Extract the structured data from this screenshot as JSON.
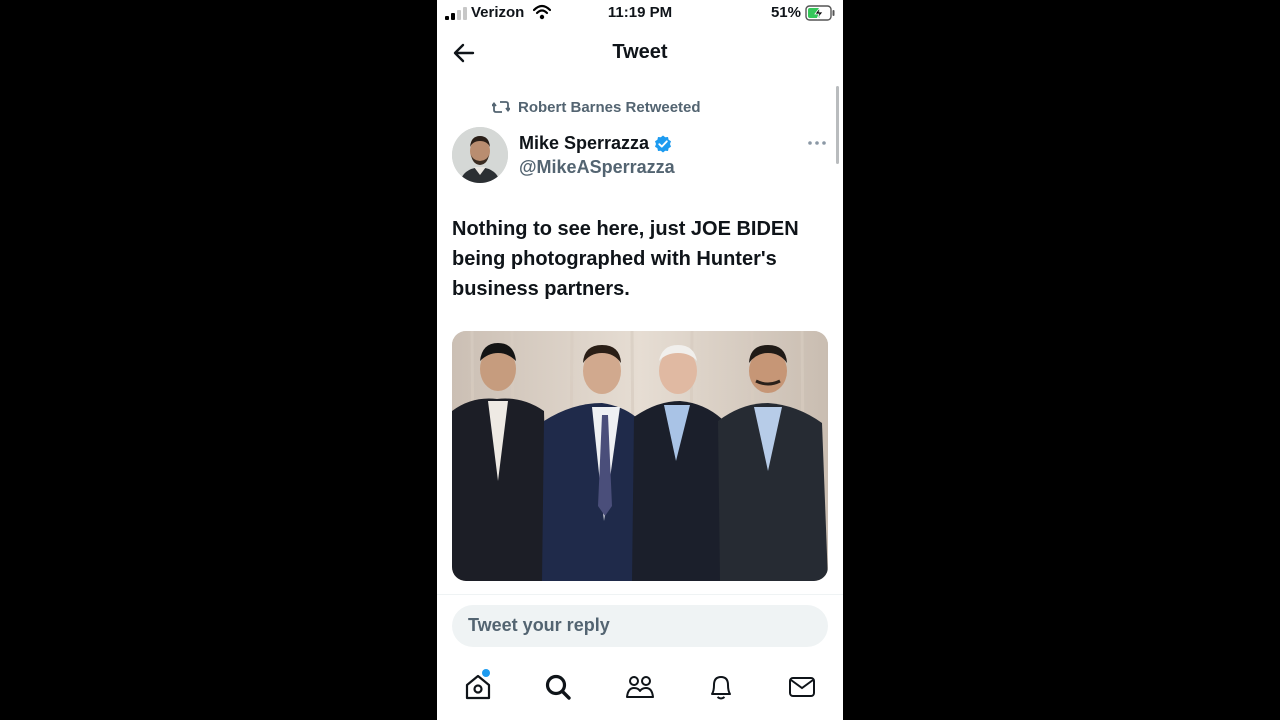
{
  "status_bar": {
    "carrier": "Verizon",
    "time": "11:19 PM",
    "battery_percent": "51%"
  },
  "header": {
    "title": "Tweet"
  },
  "tweet": {
    "retweeted_by": "Robert Barnes Retweeted",
    "author_name": "Mike Sperrazza",
    "author_handle": "@MikeASperrazza",
    "verified": true,
    "text": "Nothing to see here, just JOE BIDEN\nbeing photographed with Hunter's\nbusiness partners."
  },
  "reply": {
    "placeholder": "Tweet your reply"
  },
  "tabbar": {
    "items": [
      "home-icon",
      "search-icon",
      "communities-icon",
      "notifications-icon",
      "messages-icon"
    ],
    "home_has_notification_dot": true
  },
  "colors": {
    "accent": "#1d9bf0",
    "text": "#0f1419",
    "secondary": "#536471",
    "battery_fill": "#34c759"
  }
}
